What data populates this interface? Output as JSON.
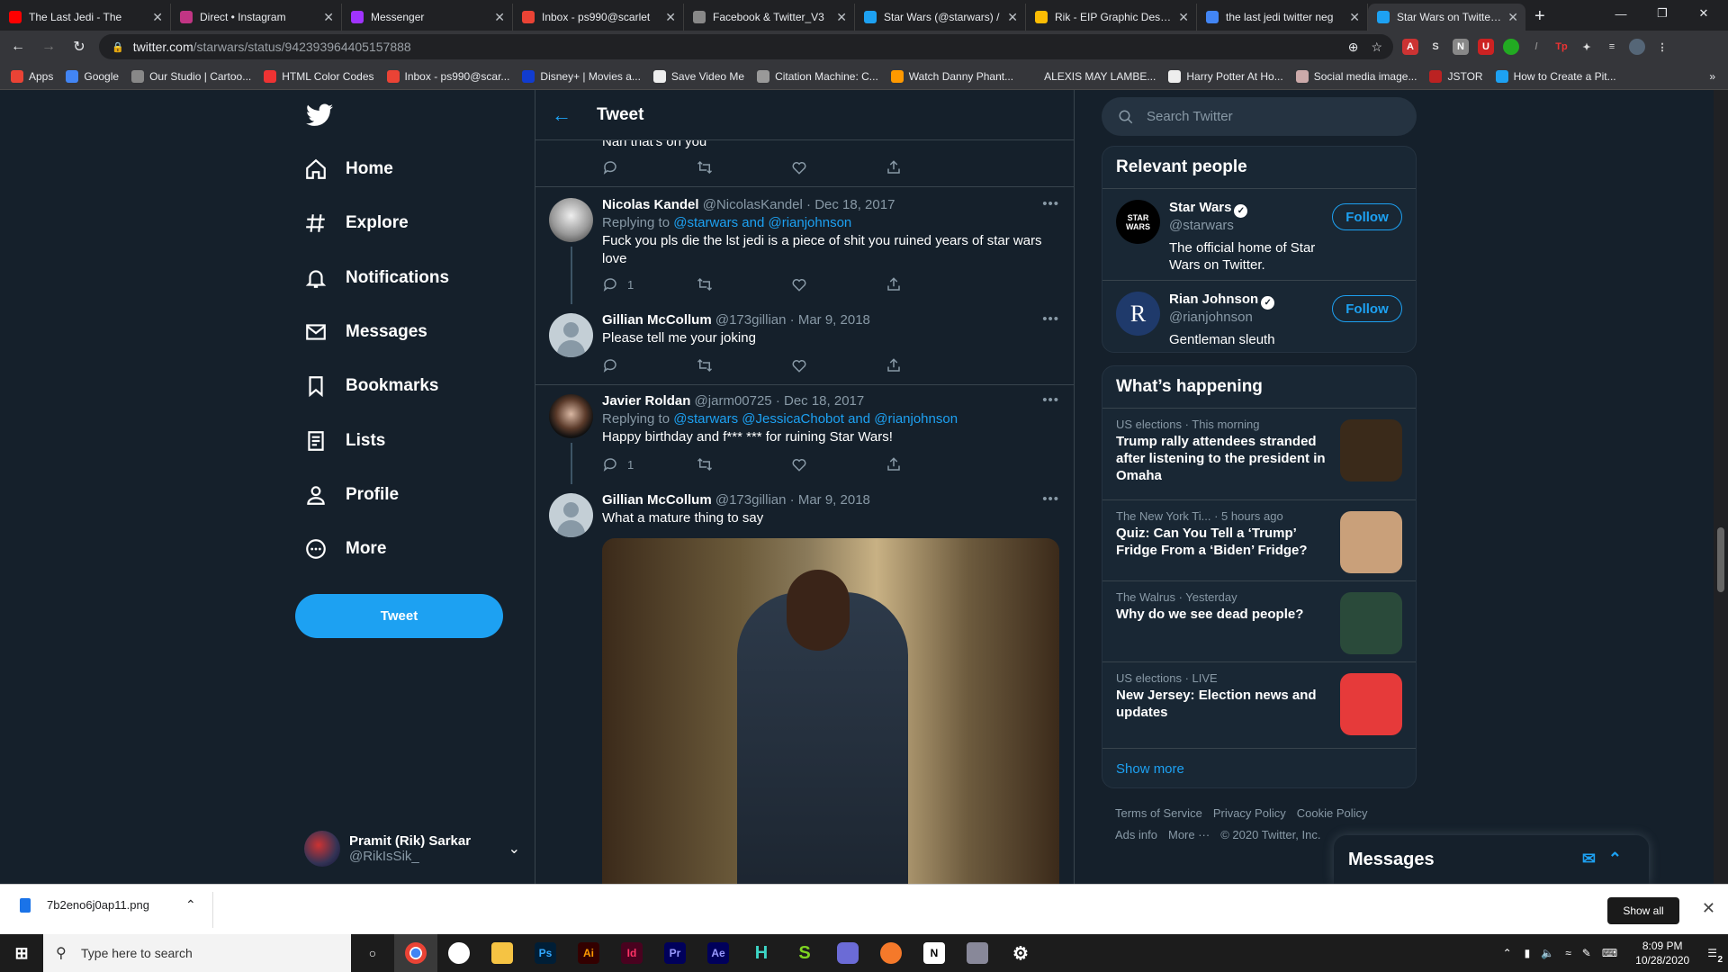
{
  "browser": {
    "tabs": [
      {
        "title": "The Last Jedi - The",
        "color": "#ff0000",
        "active": false
      },
      {
        "title": "Direct • Instagram",
        "color": "#c13584",
        "active": false
      },
      {
        "title": "Messenger",
        "color": "#a033ff",
        "active": false
      },
      {
        "title": "Inbox - ps990@scarlet",
        "color": "#ea4335",
        "active": false
      },
      {
        "title": "Facebook & Twitter_V3",
        "color": "#888888",
        "active": false
      },
      {
        "title": "Star Wars (@starwars) /",
        "color": "#1da1f2",
        "active": false
      },
      {
        "title": "Rik - EIP Graphic Design",
        "color": "#fbbc04",
        "active": false
      },
      {
        "title": "the last jedi twitter neg",
        "color": "#4285f4",
        "active": false
      },
      {
        "title": "Star Wars on Twitter: \"Y",
        "color": "#1da1f2",
        "active": true
      }
    ],
    "url_host": "twitter.com",
    "url_path": "/starwars/status/942393964405157888",
    "bookmarks": [
      {
        "label": "Apps",
        "color": "#ea4335"
      },
      {
        "label": "Google",
        "color": "#4285f4"
      },
      {
        "label": "Our Studio | Cartoo...",
        "color": "#888"
      },
      {
        "label": "HTML Color Codes",
        "color": "#e33"
      },
      {
        "label": "Inbox - ps990@scar...",
        "color": "#ea4335"
      },
      {
        "label": "Disney+ | Movies a...",
        "color": "#113ccf"
      },
      {
        "label": "Save Video Me",
        "color": "#eee"
      },
      {
        "label": "Citation Machine: C...",
        "color": "#999"
      },
      {
        "label": "Watch Danny Phant...",
        "color": "#f90"
      },
      {
        "label": "ALEXIS MAY LAMBE...",
        "color": "#35363a"
      },
      {
        "label": "Harry Potter At Ho...",
        "color": "#eee"
      },
      {
        "label": "Social media image...",
        "color": "#caa"
      },
      {
        "label": "JSTOR",
        "color": "#b22"
      },
      {
        "label": "How to Create a Pit...",
        "color": "#1da1f2"
      }
    ]
  },
  "twitter": {
    "nav": [
      {
        "label": "Home",
        "icon": "home-icon"
      },
      {
        "label": "Explore",
        "icon": "hashtag-icon"
      },
      {
        "label": "Notifications",
        "icon": "bell-icon"
      },
      {
        "label": "Messages",
        "icon": "envelope-icon"
      },
      {
        "label": "Bookmarks",
        "icon": "bookmark-icon"
      },
      {
        "label": "Lists",
        "icon": "list-icon"
      },
      {
        "label": "Profile",
        "icon": "person-icon"
      },
      {
        "label": "More",
        "icon": "more-icon"
      }
    ],
    "tweet_button": "Tweet",
    "account": {
      "name": "Pramit (Rik) Sarkar",
      "handle": "@RikIsSik_"
    },
    "header_title": "Tweet",
    "partial_tweet": {
      "text": "Nan that's on you"
    },
    "tweets": [
      {
        "name": "Nicolas Kandel",
        "handle": "@NicolasKandel",
        "date": "Dec 18, 2017",
        "replying_prefix": "Replying to ",
        "replying_links": "@starwars and @rianjohnson",
        "text": "Fuck you pls die the lst jedi is a piece of shit you ruined years of star wars love",
        "replies": "1"
      },
      {
        "name": "Gillian McCollum",
        "handle": "@173gillian",
        "date": "Mar 9, 2018",
        "text": "Please tell me your joking",
        "replies": ""
      },
      {
        "name": "Javier Roldan",
        "handle": "@jarm00725",
        "date": "Dec 18, 2017",
        "replying_prefix": "Replying to ",
        "replying_links": "@starwars @JessicaChobot and @rianjohnson",
        "text": "Happy birthday and f*** *** for ruining Star Wars!",
        "replies": "1"
      },
      {
        "name": "Gillian McCollum",
        "handle": "@173gillian",
        "date": "Mar 9, 2018",
        "text": "What a mature thing to say"
      }
    ],
    "search_placeholder": "Search Twitter",
    "relevant_title": "Relevant people",
    "people": [
      {
        "name": "Star Wars",
        "handle": "@starwars",
        "bio": "The official home of Star Wars on Twitter.",
        "follow": "Follow",
        "avatar_text": "STAR WARS"
      },
      {
        "name": "Rian Johnson",
        "handle": "@rianjohnson",
        "bio": "Gentleman sleuth",
        "follow": "Follow",
        "avatar_text": "R"
      }
    ],
    "happening_title": "What’s happening",
    "trends": [
      {
        "context": "US elections · This morning",
        "headline": "Trump rally attendees stranded after listening to the president in Omaha",
        "thumb": "#3a2a1a"
      },
      {
        "context": "The New York Ti... · 5 hours ago",
        "headline": "Quiz: Can You Tell a ‘Trump’ Fridge From a ‘Biden’ Fridge?",
        "thumb": "#c9a07a"
      },
      {
        "context": "The Walrus · Yesterday",
        "headline": "Why do we see dead people?",
        "thumb": "#2a4a3a"
      },
      {
        "context": "US elections · LIVE",
        "headline": "New Jersey: Election news and updates",
        "thumb": "#e63a3a"
      }
    ],
    "show_more": "Show more",
    "footer": [
      "Terms of Service",
      "Privacy Policy",
      "Cookie Policy",
      "Ads info",
      "More ···",
      "© 2020 Twitter, Inc."
    ],
    "messages_dock": "Messages"
  },
  "download": {
    "filename": "7b2eno6j0ap11.png",
    "show_all": "Show all"
  },
  "taskbar": {
    "search_placeholder": "Type here to search",
    "time": "8:09 PM",
    "date": "10/28/2020",
    "notif_count": "2"
  }
}
